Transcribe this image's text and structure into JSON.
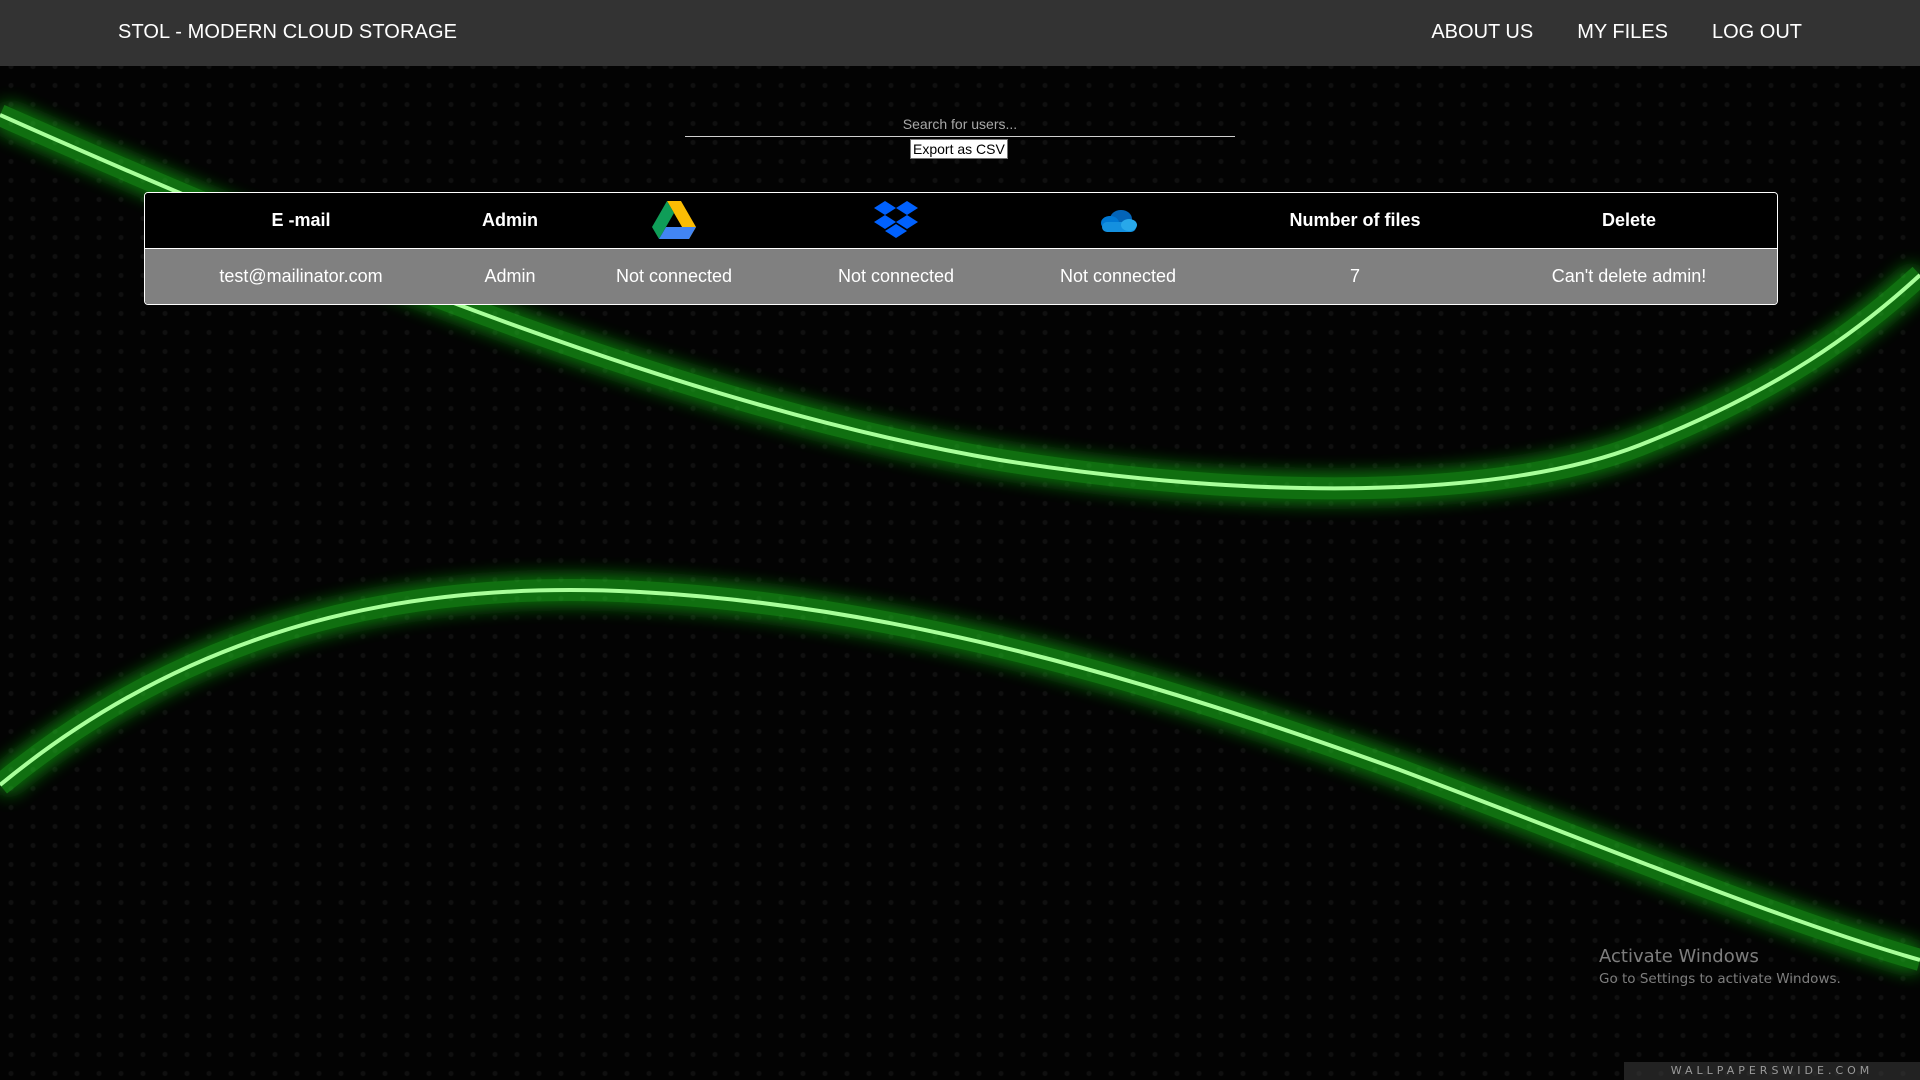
{
  "navbar": {
    "brand": "STOL - MODERN CLOUD STORAGE",
    "links": [
      "ABOUT US",
      "MY FILES",
      "LOG OUT"
    ]
  },
  "search": {
    "placeholder": "Search for users...",
    "value": ""
  },
  "export_button": "Export as CSV",
  "table": {
    "headers": {
      "email": "E -mail",
      "admin": "Admin",
      "google_drive_icon": "google-drive-icon",
      "dropbox_icon": "dropbox-icon",
      "onedrive_icon": "onedrive-icon",
      "files": "Number of files",
      "delete": "Delete"
    },
    "rows": [
      {
        "email": "test@mailinator.com",
        "admin": "Admin",
        "google_drive": "Not connected",
        "dropbox": "Not connected",
        "onedrive": "Not connected",
        "files": "7",
        "delete": "Can't delete admin!"
      }
    ]
  },
  "os_overlay": {
    "title": "Activate Windows",
    "subtitle": "Go to Settings to activate Windows."
  },
  "watermark": "WALLPAPERSWIDE.COM",
  "colors": {
    "navbar": "#333333",
    "accent_green": "#3cff3c",
    "table_header_bg": "#000000",
    "table_row_bg": "#808080"
  }
}
